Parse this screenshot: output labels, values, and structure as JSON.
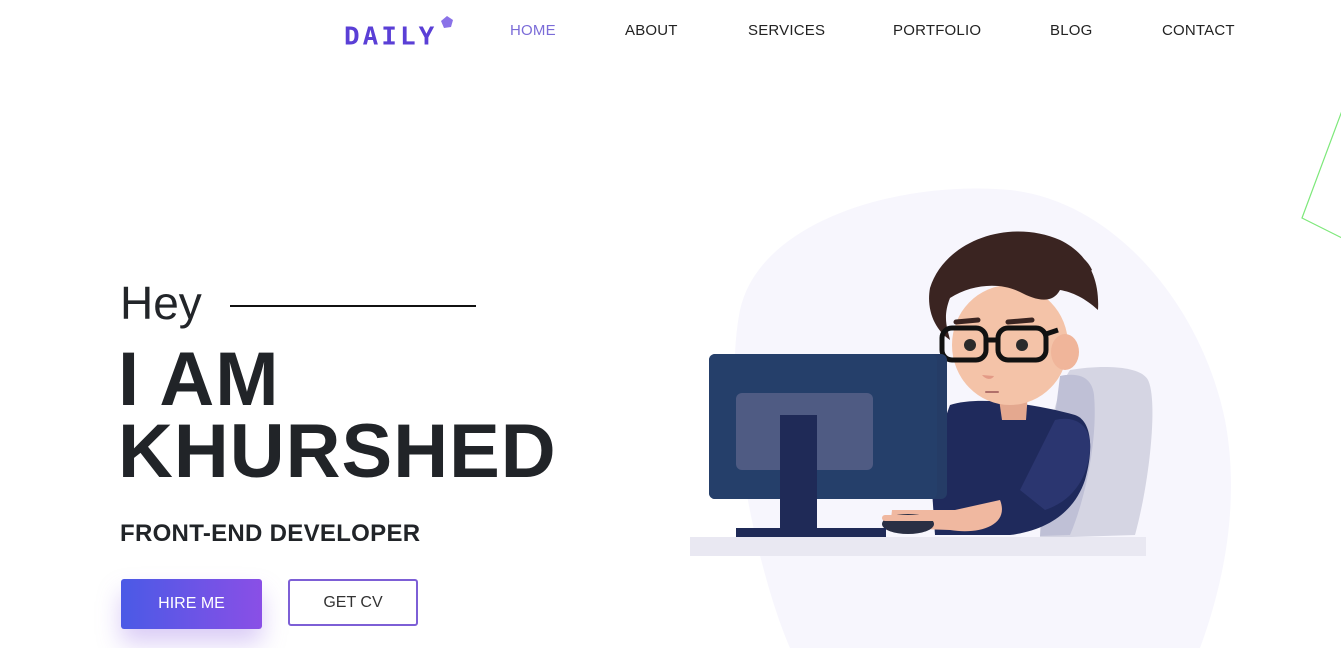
{
  "logo": {
    "text": "DAILY",
    "accent": "#8a72e8"
  },
  "nav": {
    "items": [
      {
        "label": "HOME",
        "active": true
      },
      {
        "label": "ABOUT"
      },
      {
        "label": "SERVICES"
      },
      {
        "label": "PORTFOLIO"
      },
      {
        "label": "BLOG"
      },
      {
        "label": "CONTACT"
      }
    ]
  },
  "hero": {
    "greeting": "Hey",
    "headline_line1": "I AM",
    "headline_line2": "KHURSHED",
    "role": "FRONT-END DEVELOPER",
    "hire_button": "HIRE ME",
    "cv_button": "GET CV"
  },
  "colors": {
    "accent": "#7b6cd8",
    "button_gradient_start": "#4a5ae6",
    "button_gradient_end": "#8a4fe6",
    "text_dark": "#212428"
  },
  "illustration": {
    "subject": "developer-at-computer-illustration"
  }
}
